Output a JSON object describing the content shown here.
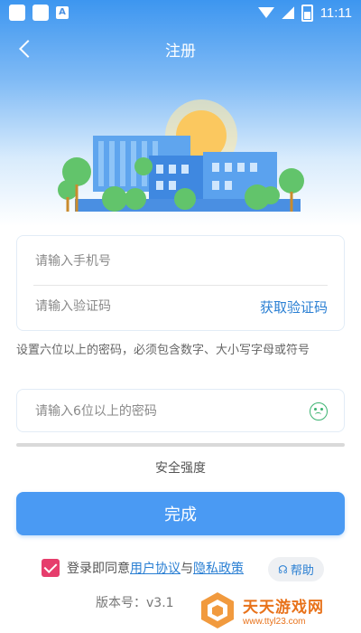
{
  "status_bar": {
    "time": "11:11",
    "icons": [
      "app-icon",
      "app-icon",
      "a-icon",
      "wifi-icon",
      "signal-icon",
      "battery-icon"
    ]
  },
  "nav": {
    "title": "注册",
    "back_icon": "chevron-left-icon"
  },
  "form": {
    "phone_placeholder": "请输入手机号",
    "code_placeholder": "请输入验证码",
    "get_code_label": "获取验证码",
    "password_hint": "设置六位以上的密码，必须包含数字、大小写字母或符号",
    "password_placeholder": "请输入6位以上的密码",
    "strength_label": "安全强度"
  },
  "actions": {
    "done_label": "完成"
  },
  "agreement": {
    "checked": true,
    "prefix": "登录即同意",
    "user_agreement": "用户协议",
    "joiner": "与",
    "privacy_policy": "隐私政策",
    "help_label": "帮助"
  },
  "version": {
    "text": "版本号：v3.1"
  },
  "watermark": {
    "title": "天天游戏网",
    "url": "www.ttyl23.com"
  },
  "colors": {
    "primary": "#4a9af3",
    "link": "#2a7fd3",
    "checkbox": "#e63d6c",
    "accent_watermark": "#e8721a"
  }
}
